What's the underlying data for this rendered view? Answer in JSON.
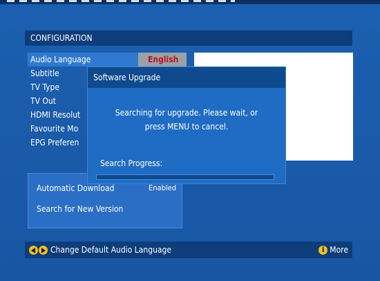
{
  "header": {
    "title": "CONFIGURATION"
  },
  "menu": {
    "items": [
      {
        "label": "Audio Language"
      },
      {
        "label": "Subtitle"
      },
      {
        "label": "TV Type"
      },
      {
        "label": "TV Out"
      },
      {
        "label": "HDMI Resolut"
      },
      {
        "label": "Favourite Mo"
      },
      {
        "label": "EPG Preferen"
      }
    ],
    "selected_value": "English"
  },
  "sub_panel": {
    "auto_download_label": "Automatic Download",
    "auto_download_value": "Enabled",
    "search_label": "Search for New Version"
  },
  "dialog": {
    "title": "Software Upgrade",
    "message_line1": "Searching for upgrade. Please wait, or",
    "message_line2": "press MENU to cancel.",
    "progress_label": "Search Progress:",
    "progress_fraction": 0.0
  },
  "footer": {
    "hint": "Change Default Audio Language",
    "info_label": "More"
  },
  "colors": {
    "background": "#1a5aa8",
    "highlight_value": "#c0121b",
    "button_yellow": "#f3c21b"
  }
}
